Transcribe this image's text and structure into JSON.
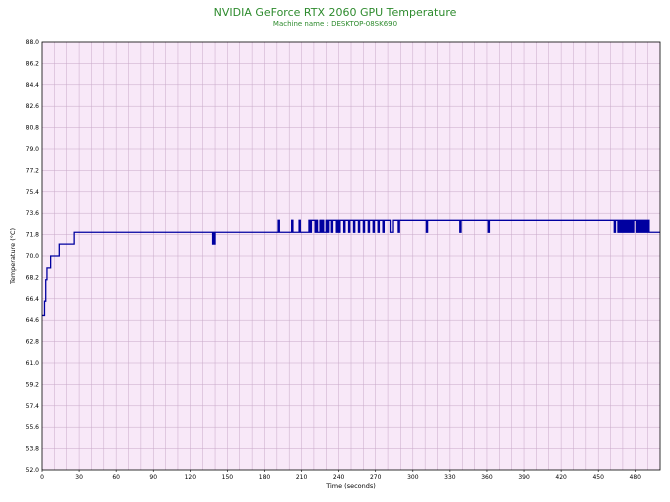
{
  "chart_data": {
    "type": "line",
    "title": "NVIDIA GeForce RTX 2060 GPU Temperature",
    "subtitle": "Machine name : DESKTOP-08SK690",
    "xlabel": "Time (seconds)",
    "ylabel": "Temperature (°C)",
    "xlim": [
      0,
      500
    ],
    "ylim": [
      52.0,
      88.0
    ],
    "x_ticks": [
      "0",
      "30",
      "60",
      "90",
      "120",
      "150",
      "180",
      "210",
      "240",
      "270",
      "300",
      "330",
      "360",
      "390",
      "420",
      "450",
      "480"
    ],
    "y_ticks": [
      "52.0",
      "53.8",
      "55.6",
      "57.4",
      "59.2",
      "61.0",
      "62.8",
      "64.6",
      "66.4",
      "68.2",
      "70.0",
      "71.8",
      "73.6",
      "75.4",
      "77.2",
      "79.0",
      "80.8",
      "82.6",
      "84.4",
      "86.2",
      "88.0"
    ],
    "grid": true,
    "colors": {
      "line": "#0000a0",
      "plot_bg": "#f8e8f8",
      "grid": "#c8a8c8",
      "title": "#2e8b2e"
    },
    "series": [
      {
        "x": [
          0,
          1,
          2,
          3,
          4,
          5,
          6,
          7,
          8,
          10,
          14,
          15,
          26,
          27,
          137,
          138,
          138.5,
          139,
          140,
          190,
          191,
          192,
          201,
          202,
          203,
          207,
          208,
          209,
          215,
          216,
          217,
          218,
          220,
          221,
          222,
          223,
          225,
          226,
          227,
          228,
          230,
          231,
          232,
          233,
          234,
          235,
          236,
          238,
          239,
          240,
          241,
          243,
          244,
          245,
          246,
          248,
          249,
          250,
          252,
          253,
          254,
          256,
          257,
          258,
          260,
          261,
          262,
          264,
          265,
          266,
          268,
          269,
          270,
          272,
          273,
          274,
          276,
          277,
          278,
          280,
          281,
          282,
          284,
          285,
          286,
          288,
          289,
          290,
          310,
          311,
          312,
          337,
          338,
          339,
          360,
          361,
          362,
          462,
          463,
          464,
          465,
          466,
          467,
          468,
          469,
          470,
          471,
          472,
          473,
          474,
          475,
          476,
          477,
          478,
          479,
          480,
          481,
          482,
          483,
          484,
          485,
          486,
          487,
          488,
          489,
          490,
          491,
          492,
          500
        ],
        "y": [
          65.0,
          65.0,
          66.2,
          68.0,
          69.0,
          69.0,
          69.0,
          70.0,
          70.0,
          70.0,
          71.0,
          71.0,
          72.0,
          72.0,
          72.0,
          71.0,
          72.0,
          71.0,
          72.0,
          72.0,
          73.0,
          72.0,
          72.0,
          73.0,
          72.0,
          72.0,
          73.0,
          72.0,
          72.0,
          73.0,
          72.0,
          73.0,
          73.0,
          72.0,
          73.0,
          72.0,
          73.0,
          72.0,
          73.0,
          72.0,
          73.0,
          72.0,
          73.0,
          73.0,
          72.0,
          73.0,
          73.0,
          72.0,
          73.0,
          72.0,
          73.0,
          73.0,
          72.0,
          73.0,
          73.0,
          72.0,
          73.0,
          73.0,
          72.0,
          73.0,
          73.0,
          72.0,
          73.0,
          73.0,
          72.0,
          73.0,
          73.0,
          72.0,
          73.0,
          73.0,
          72.0,
          73.0,
          73.0,
          72.0,
          73.0,
          73.0,
          72.0,
          73.0,
          73.0,
          73.0,
          73.0,
          72.0,
          73.0,
          73.0,
          73.0,
          72.0,
          73.0,
          73.0,
          73.0,
          72.0,
          73.0,
          73.0,
          72.0,
          73.0,
          73.0,
          72.0,
          73.0,
          73.0,
          72.0,
          73.0,
          73.0,
          72.0,
          73.0,
          72.0,
          73.0,
          72.0,
          73.0,
          72.0,
          73.0,
          72.0,
          73.0,
          72.0,
          73.0,
          72.0,
          73.0,
          73.0,
          72.0,
          73.0,
          72.0,
          73.0,
          72.0,
          73.0,
          72.0,
          73.0,
          72.0,
          73.0,
          72.0,
          72.0,
          72.0
        ]
      }
    ]
  }
}
